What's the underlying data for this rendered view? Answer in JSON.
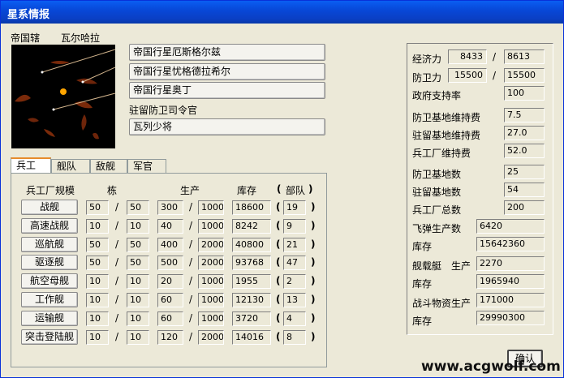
{
  "window": {
    "title": "星系情报"
  },
  "header": {
    "label": "帝国辖",
    "value": "瓦尔哈拉"
  },
  "planets": [
    "帝国行星厄斯格尔兹",
    "帝国行星忧格德拉希尔",
    "帝国行星奥丁"
  ],
  "defense": {
    "label": "驻留防卫司令官",
    "commander": "瓦列少将"
  },
  "tabs": [
    "兵工",
    "舰队",
    "敌舰",
    "军官"
  ],
  "factory": {
    "headers": {
      "scale": "兵工厂规模",
      "count": "栋",
      "produce": "生产",
      "stock": "库存",
      "units": "部队"
    },
    "rows": [
      {
        "name": "战舰",
        "a": "50",
        "b": "50",
        "p1": "300",
        "p2": "1000",
        "stock": "18600",
        "units": "19"
      },
      {
        "name": "高速战舰",
        "a": "10",
        "b": "10",
        "p1": "40",
        "p2": "1000",
        "stock": "8242",
        "units": "9"
      },
      {
        "name": "巡航舰",
        "a": "50",
        "b": "50",
        "p1": "400",
        "p2": "2000",
        "stock": "40800",
        "units": "21"
      },
      {
        "name": "驱逐舰",
        "a": "50",
        "b": "50",
        "p1": "500",
        "p2": "2000",
        "stock": "93768",
        "units": "47"
      },
      {
        "name": "航空母舰",
        "a": "10",
        "b": "10",
        "p1": "20",
        "p2": "1000",
        "stock": "1955",
        "units": "2"
      },
      {
        "name": "工作舰",
        "a": "10",
        "b": "10",
        "p1": "60",
        "p2": "1000",
        "stock": "12130",
        "units": "13"
      },
      {
        "name": "运输舰",
        "a": "10",
        "b": "10",
        "p1": "60",
        "p2": "1000",
        "stock": "3720",
        "units": "4"
      },
      {
        "name": "突击登陆舰",
        "a": "10",
        "b": "10",
        "p1": "120",
        "p2": "2000",
        "stock": "14016",
        "units": "8"
      }
    ]
  },
  "economy": {
    "econ": {
      "label": "经济力",
      "v1": "8433",
      "v2": "8613"
    },
    "def": {
      "label": "防卫力",
      "v1": "15500",
      "v2": "15500"
    },
    "support": {
      "label": "政府支持率",
      "v": "100"
    }
  },
  "costs": [
    {
      "label": "防卫基地维持费",
      "v": "7.5"
    },
    {
      "label": "驻留基地维持费",
      "v": "27.0"
    },
    {
      "label": "兵工厂维持费",
      "v": "52.0"
    }
  ],
  "bases": [
    {
      "label": "防卫基地数",
      "v": "25"
    },
    {
      "label": "驻留基地数",
      "v": "54"
    },
    {
      "label": "兵工厂总数",
      "v": "200"
    }
  ],
  "production": {
    "missile_label": "飞弹生产数",
    "missile": "6420",
    "stock_label": "库存",
    "missile_stock": "15642360",
    "carrier_label": "舰载艇",
    "carrier_prod_label": "生产",
    "carrier": "2270",
    "carrier_stock": "1965940",
    "supply_label": "战斗物资生产",
    "supply": "171000",
    "supply_stock": "29990300"
  },
  "ok_label": "确认",
  "watermark": "www.acgwolf.com"
}
